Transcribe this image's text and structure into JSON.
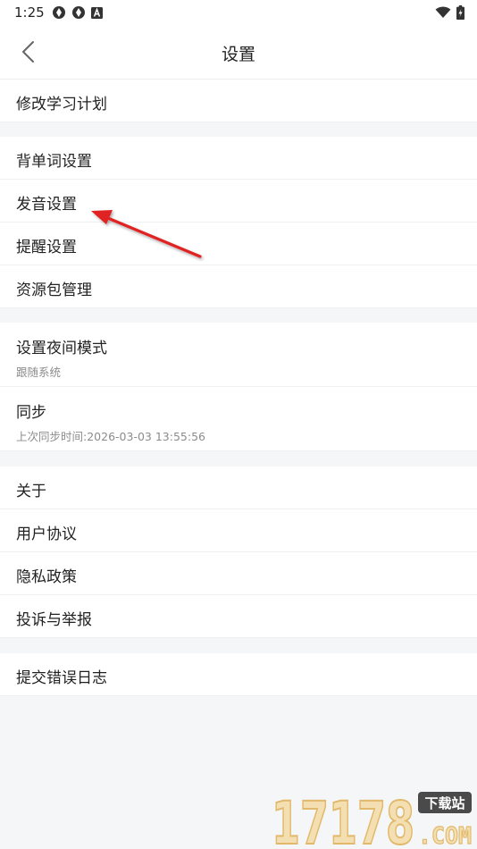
{
  "status_bar": {
    "time": "1:25",
    "icons": [
      "vpn-icon",
      "vpn-icon",
      "notification-a-icon",
      "wifi-icon",
      "battery-charging-icon"
    ]
  },
  "header": {
    "title": "设置",
    "back_icon": "chevron-left-icon"
  },
  "groups": [
    {
      "items": [
        {
          "label": "修改学习计划"
        }
      ]
    },
    {
      "items": [
        {
          "label": "背单词设置"
        },
        {
          "label": "发音设置"
        },
        {
          "label": "提醒设置"
        },
        {
          "label": "资源包管理"
        }
      ]
    },
    {
      "items": [
        {
          "label": "设置夜间模式",
          "sub": "跟随系统"
        },
        {
          "label": "同步",
          "sub": "上次同步时间:2026-03-03 13:55:56"
        }
      ]
    },
    {
      "items": [
        {
          "label": "关于"
        },
        {
          "label": "用户协议"
        },
        {
          "label": "隐私政策"
        },
        {
          "label": "投诉与举报"
        }
      ]
    },
    {
      "items": [
        {
          "label": "提交错误日志"
        }
      ]
    }
  ],
  "watermark": {
    "number": "17178",
    "badge": "下载站",
    "domain": ".COM"
  },
  "colors": {
    "annotation_arrow": "#e02020",
    "page_background": "#f4f6f8",
    "watermark": "#e7c07a"
  }
}
